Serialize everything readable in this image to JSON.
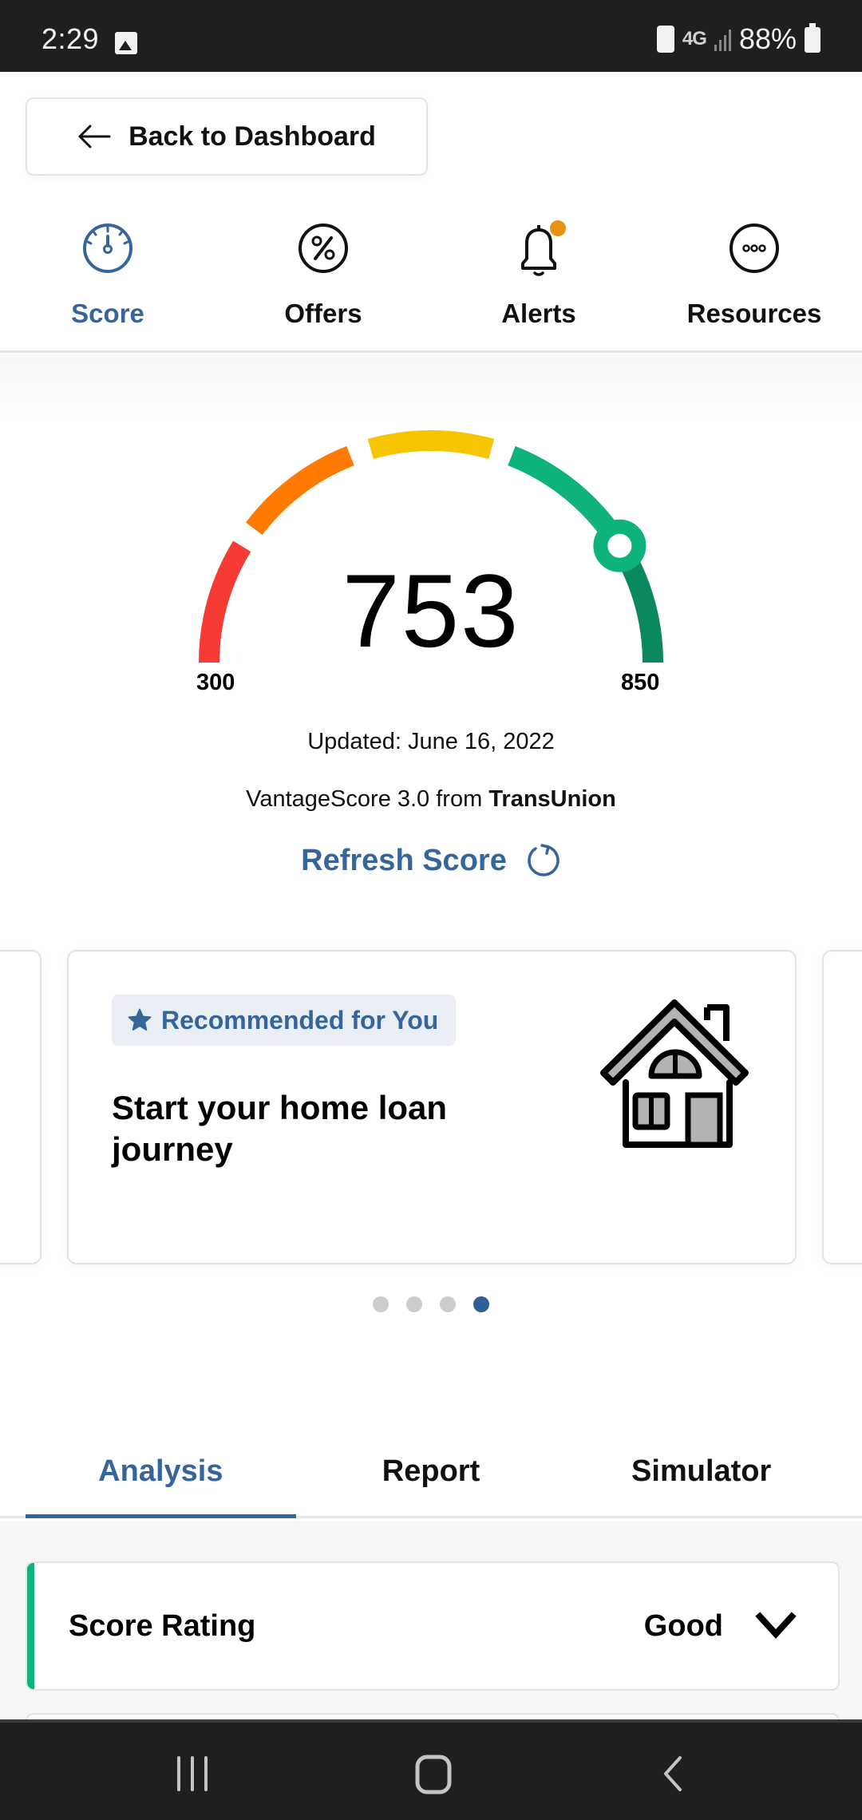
{
  "status_bar": {
    "time": "2:29",
    "network": "4G",
    "battery": "88%",
    "icons": [
      "gallery-icon",
      "battery-saver-icon",
      "lte-icon",
      "signal-icon",
      "battery-icon"
    ]
  },
  "back_button": {
    "label": "Back to Dashboard",
    "icon": "arrow-left-icon"
  },
  "top_nav": {
    "items": [
      {
        "label": "Score",
        "icon": "speedometer-icon",
        "active": true
      },
      {
        "label": "Offers",
        "icon": "percent-icon",
        "active": false
      },
      {
        "label": "Alerts",
        "icon": "bell-icon",
        "active": false,
        "badge": true
      },
      {
        "label": "Resources",
        "icon": "more-icon",
        "active": false
      }
    ]
  },
  "score": {
    "value": "753",
    "min_label": "300",
    "max_label": "850",
    "min": 300,
    "max": 850,
    "current": 753,
    "updated": "Updated: June 16, 2022",
    "provider_prefix": "VantageScore 3.0 from ",
    "provider_bureau": "TransUnion",
    "refresh_label": "Refresh Score",
    "segments": [
      {
        "name": "poor",
        "color": "#f53b33"
      },
      {
        "name": "fair",
        "color": "#ff7a00"
      },
      {
        "name": "average",
        "color": "#f7c500"
      },
      {
        "name": "good",
        "color": "#0eb27b"
      },
      {
        "name": "excellent",
        "color": "#0a8a5c"
      }
    ]
  },
  "carousel": {
    "badge": "Recommended for You",
    "title": "Start your home loan journey",
    "illustration": "house-icon",
    "page_count": 4,
    "active_page": 4
  },
  "tabs": [
    {
      "label": "Analysis",
      "active": true
    },
    {
      "label": "Report",
      "active": false
    },
    {
      "label": "Simulator",
      "active": false
    }
  ],
  "rating": {
    "label": "Score Rating",
    "value": "Good",
    "accent": "#0eb27b"
  },
  "colors": {
    "accent": "#35659a",
    "alert_dot": "#e8930f"
  }
}
